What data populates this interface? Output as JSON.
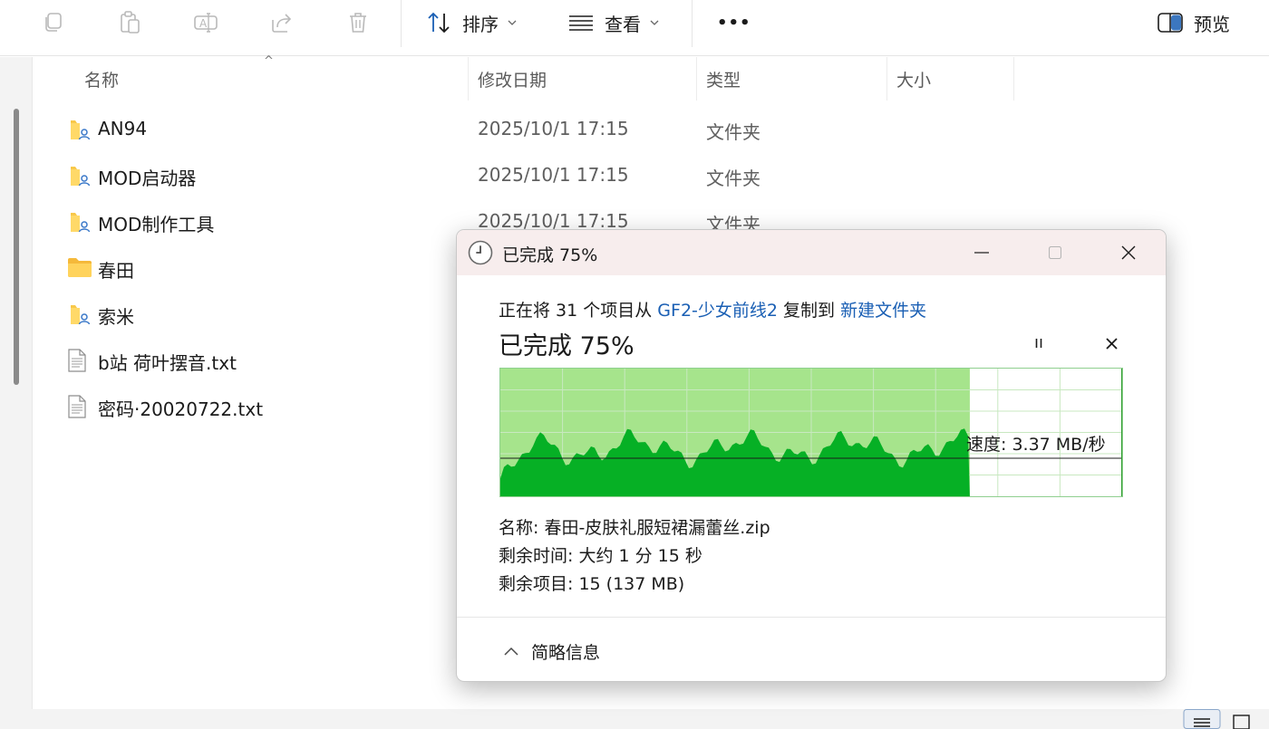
{
  "toolbar": {
    "sort_label": "排序",
    "view_label": "查看",
    "more_label": "•••",
    "preview_label": "预览"
  },
  "columns": {
    "name": "名称",
    "date": "修改日期",
    "type": "类型",
    "size": "大小"
  },
  "files": [
    {
      "name": "AN94",
      "date": "2025/10/1 17:15",
      "type": "文件夹",
      "icon": "shared-folder-icon"
    },
    {
      "name": "MOD启动器",
      "date": "2025/10/1 17:15",
      "type": "文件夹",
      "icon": "shared-folder-icon"
    },
    {
      "name": "MOD制作工具",
      "date": "2025/10/1 17:15",
      "type": "文件夹",
      "icon": "shared-folder-icon"
    },
    {
      "name": "春田",
      "date": "",
      "type": "",
      "icon": "folder-icon"
    },
    {
      "name": "索米",
      "date": "",
      "type": "",
      "icon": "shared-folder-icon"
    },
    {
      "name": "b站 荷叶摆音.txt",
      "date": "",
      "type": "",
      "icon": "text-file-icon"
    },
    {
      "name": "密码·20020722.txt",
      "date": "",
      "type": "",
      "icon": "text-file-icon"
    }
  ],
  "dialog": {
    "title": "已完成 75%",
    "desc_prefix": "正在将 31 个项目从 ",
    "source": "GF2-少女前线2",
    "desc_middle": " 复制到 ",
    "destination": "新建文件夹",
    "percent_label": "已完成 75%",
    "progress": 0.755,
    "speed": "速度: 3.37 MB/秒",
    "name_line": "名称: 春田-皮肤礼服短裙漏蕾丝.zip",
    "time_line": "剩余时间: 大约 1 分 15 秒",
    "items_line": "剩余项目: 15 (137 MB)",
    "less_details": "简略信息"
  },
  "colors": {
    "accent_link": "#1a5fb4",
    "graph_fill_light": "#a6e48c",
    "graph_fill_dark": "#06b025",
    "title_bar": "#f7eded"
  }
}
